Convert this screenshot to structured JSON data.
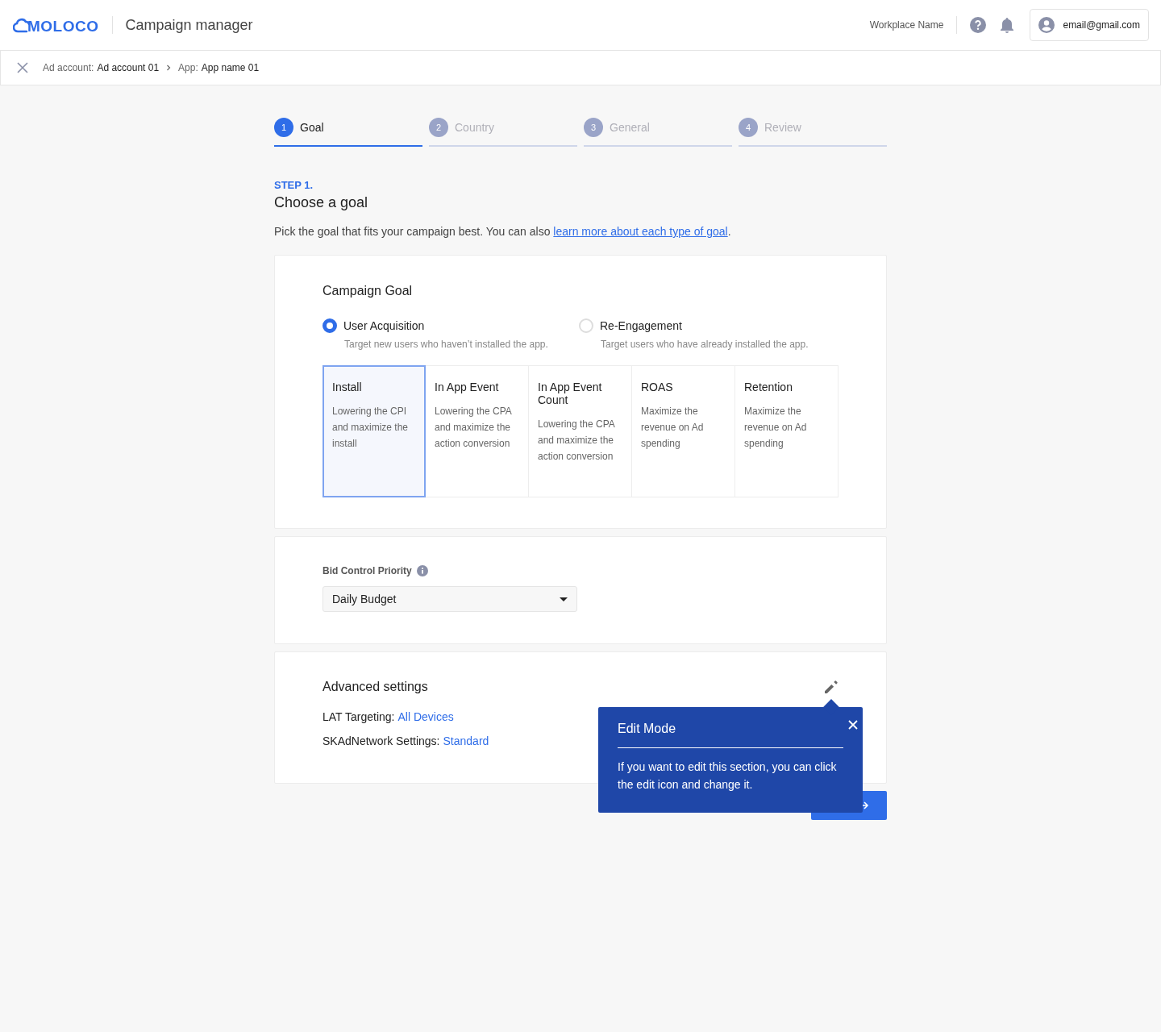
{
  "header": {
    "logo_text": "MOLOCO",
    "app_title": "Campaign manager",
    "workplace": "Workplace Name",
    "email": "email@gmail.com"
  },
  "breadcrumb": [
    {
      "label": "Ad account:",
      "value": "Ad account 01"
    },
    {
      "label": "App:",
      "value": "App name 01"
    }
  ],
  "steps": [
    {
      "number": "1",
      "label": "Goal",
      "selected": true
    },
    {
      "number": "2",
      "label": "Country",
      "selected": false
    },
    {
      "number": "3",
      "label": "General",
      "selected": false
    },
    {
      "number": "4",
      "label": "Review",
      "selected": false
    }
  ],
  "step_label": "STEP 1.",
  "heading": "Choose a goal",
  "intro": {
    "text": "Pick the goal that fits your campaign best. You can also ",
    "link": "learn more about each type of goal",
    "end": "."
  },
  "campaign_goal": {
    "title": "Campaign Goal",
    "options": [
      {
        "label": "User Acquisition",
        "description": "Target new users who haven’t installed the app.",
        "selected": true
      },
      {
        "label": "Re-Engagement",
        "description": "Target users who have already installed the app.",
        "selected": false
      }
    ],
    "goals": [
      {
        "title": "Install",
        "description": "Lowering the CPI and maximize the install",
        "selected": true
      },
      {
        "title": "In App Event",
        "description": "Lowering the CPA and maximize the action conversion",
        "selected": false
      },
      {
        "title": "In App Event Count",
        "description": "Lowering the CPA and maximize the action conversion",
        "selected": false
      },
      {
        "title": "ROAS",
        "description": "Maximize the revenue on Ad spending",
        "selected": false
      },
      {
        "title": "Retention",
        "description": "Maximize the revenue on Ad spending",
        "selected": false
      }
    ]
  },
  "bid_control": {
    "label": "Bid Control Priority",
    "value": "Daily Budget"
  },
  "advanced": {
    "title": "Advanced settings",
    "settings": [
      {
        "label": "LAT Targeting:",
        "value": "All Devices"
      },
      {
        "label": "SKAdNetwork Settings:",
        "value": "Standard"
      }
    ]
  },
  "tooltip": {
    "title": "Edit Mode",
    "body": "If you want to edit this section, you can click the edit icon and change it."
  }
}
